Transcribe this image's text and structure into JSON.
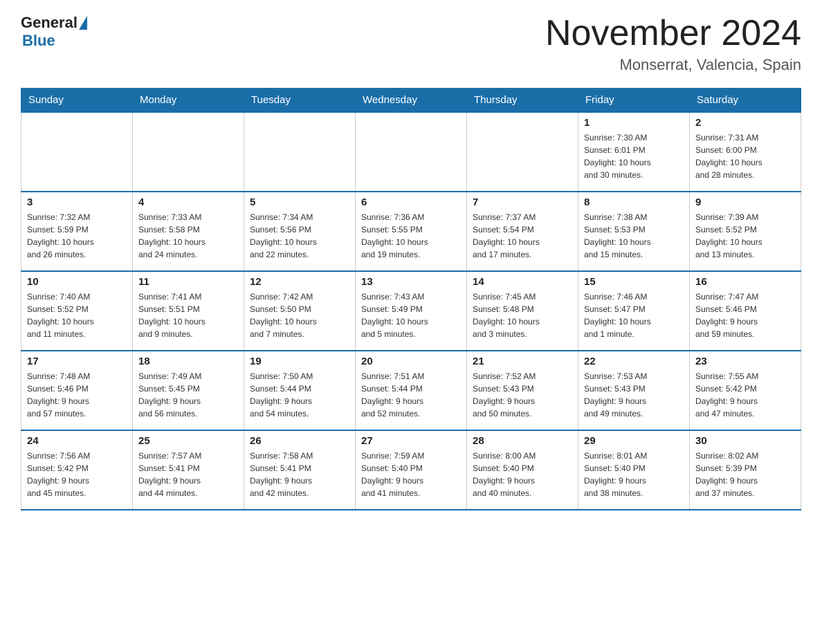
{
  "header": {
    "logo_general": "General",
    "logo_blue": "Blue",
    "month_title": "November 2024",
    "location": "Monserrat, Valencia, Spain"
  },
  "weekdays": [
    "Sunday",
    "Monday",
    "Tuesday",
    "Wednesday",
    "Thursday",
    "Friday",
    "Saturday"
  ],
  "weeks": [
    [
      {
        "day": "",
        "info": ""
      },
      {
        "day": "",
        "info": ""
      },
      {
        "day": "",
        "info": ""
      },
      {
        "day": "",
        "info": ""
      },
      {
        "day": "",
        "info": ""
      },
      {
        "day": "1",
        "info": "Sunrise: 7:30 AM\nSunset: 6:01 PM\nDaylight: 10 hours\nand 30 minutes."
      },
      {
        "day": "2",
        "info": "Sunrise: 7:31 AM\nSunset: 6:00 PM\nDaylight: 10 hours\nand 28 minutes."
      }
    ],
    [
      {
        "day": "3",
        "info": "Sunrise: 7:32 AM\nSunset: 5:59 PM\nDaylight: 10 hours\nand 26 minutes."
      },
      {
        "day": "4",
        "info": "Sunrise: 7:33 AM\nSunset: 5:58 PM\nDaylight: 10 hours\nand 24 minutes."
      },
      {
        "day": "5",
        "info": "Sunrise: 7:34 AM\nSunset: 5:56 PM\nDaylight: 10 hours\nand 22 minutes."
      },
      {
        "day": "6",
        "info": "Sunrise: 7:36 AM\nSunset: 5:55 PM\nDaylight: 10 hours\nand 19 minutes."
      },
      {
        "day": "7",
        "info": "Sunrise: 7:37 AM\nSunset: 5:54 PM\nDaylight: 10 hours\nand 17 minutes."
      },
      {
        "day": "8",
        "info": "Sunrise: 7:38 AM\nSunset: 5:53 PM\nDaylight: 10 hours\nand 15 minutes."
      },
      {
        "day": "9",
        "info": "Sunrise: 7:39 AM\nSunset: 5:52 PM\nDaylight: 10 hours\nand 13 minutes."
      }
    ],
    [
      {
        "day": "10",
        "info": "Sunrise: 7:40 AM\nSunset: 5:52 PM\nDaylight: 10 hours\nand 11 minutes."
      },
      {
        "day": "11",
        "info": "Sunrise: 7:41 AM\nSunset: 5:51 PM\nDaylight: 10 hours\nand 9 minutes."
      },
      {
        "day": "12",
        "info": "Sunrise: 7:42 AM\nSunset: 5:50 PM\nDaylight: 10 hours\nand 7 minutes."
      },
      {
        "day": "13",
        "info": "Sunrise: 7:43 AM\nSunset: 5:49 PM\nDaylight: 10 hours\nand 5 minutes."
      },
      {
        "day": "14",
        "info": "Sunrise: 7:45 AM\nSunset: 5:48 PM\nDaylight: 10 hours\nand 3 minutes."
      },
      {
        "day": "15",
        "info": "Sunrise: 7:46 AM\nSunset: 5:47 PM\nDaylight: 10 hours\nand 1 minute."
      },
      {
        "day": "16",
        "info": "Sunrise: 7:47 AM\nSunset: 5:46 PM\nDaylight: 9 hours\nand 59 minutes."
      }
    ],
    [
      {
        "day": "17",
        "info": "Sunrise: 7:48 AM\nSunset: 5:46 PM\nDaylight: 9 hours\nand 57 minutes."
      },
      {
        "day": "18",
        "info": "Sunrise: 7:49 AM\nSunset: 5:45 PM\nDaylight: 9 hours\nand 56 minutes."
      },
      {
        "day": "19",
        "info": "Sunrise: 7:50 AM\nSunset: 5:44 PM\nDaylight: 9 hours\nand 54 minutes."
      },
      {
        "day": "20",
        "info": "Sunrise: 7:51 AM\nSunset: 5:44 PM\nDaylight: 9 hours\nand 52 minutes."
      },
      {
        "day": "21",
        "info": "Sunrise: 7:52 AM\nSunset: 5:43 PM\nDaylight: 9 hours\nand 50 minutes."
      },
      {
        "day": "22",
        "info": "Sunrise: 7:53 AM\nSunset: 5:43 PM\nDaylight: 9 hours\nand 49 minutes."
      },
      {
        "day": "23",
        "info": "Sunrise: 7:55 AM\nSunset: 5:42 PM\nDaylight: 9 hours\nand 47 minutes."
      }
    ],
    [
      {
        "day": "24",
        "info": "Sunrise: 7:56 AM\nSunset: 5:42 PM\nDaylight: 9 hours\nand 45 minutes."
      },
      {
        "day": "25",
        "info": "Sunrise: 7:57 AM\nSunset: 5:41 PM\nDaylight: 9 hours\nand 44 minutes."
      },
      {
        "day": "26",
        "info": "Sunrise: 7:58 AM\nSunset: 5:41 PM\nDaylight: 9 hours\nand 42 minutes."
      },
      {
        "day": "27",
        "info": "Sunrise: 7:59 AM\nSunset: 5:40 PM\nDaylight: 9 hours\nand 41 minutes."
      },
      {
        "day": "28",
        "info": "Sunrise: 8:00 AM\nSunset: 5:40 PM\nDaylight: 9 hours\nand 40 minutes."
      },
      {
        "day": "29",
        "info": "Sunrise: 8:01 AM\nSunset: 5:40 PM\nDaylight: 9 hours\nand 38 minutes."
      },
      {
        "day": "30",
        "info": "Sunrise: 8:02 AM\nSunset: 5:39 PM\nDaylight: 9 hours\nand 37 minutes."
      }
    ]
  ]
}
